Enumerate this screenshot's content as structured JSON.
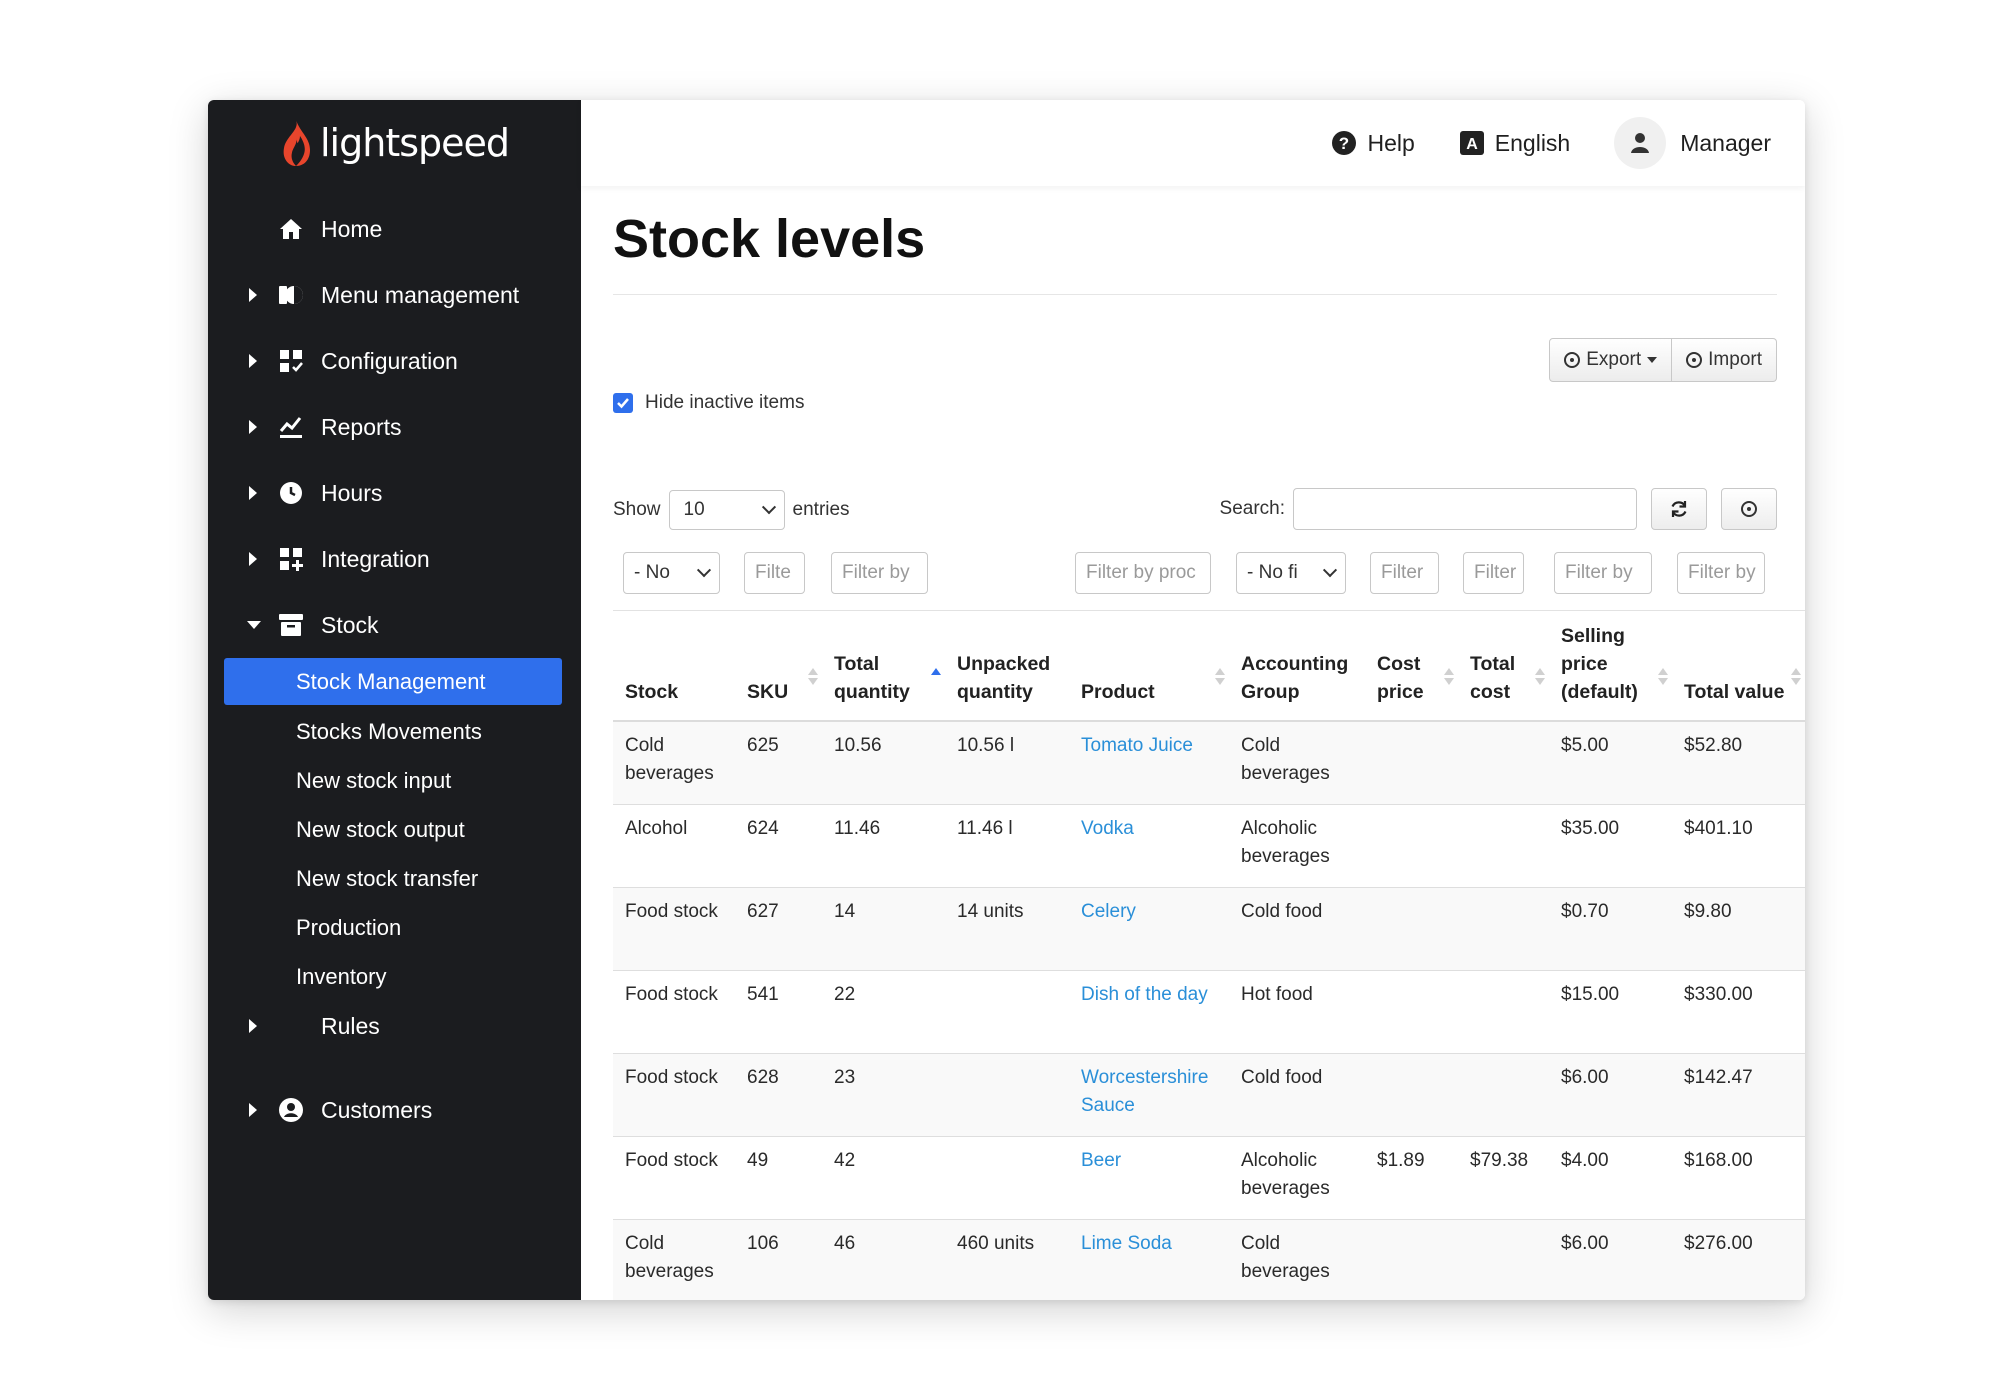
{
  "app": {
    "brand": "lightspeed",
    "accent_color": "#2f6fec",
    "brand_color": "#e8452c"
  },
  "sidebar": {
    "items": [
      {
        "label": "Home",
        "icon": "home-icon"
      },
      {
        "label": "Menu management",
        "icon": "menu-management-icon"
      },
      {
        "label": "Configuration",
        "icon": "configuration-icon"
      },
      {
        "label": "Reports",
        "icon": "reports-icon"
      },
      {
        "label": "Hours",
        "icon": "clock-icon"
      },
      {
        "label": "Integration",
        "icon": "integration-icon"
      },
      {
        "label": "Stock",
        "icon": "stock-icon"
      }
    ],
    "stock_subitems": [
      "Stock Management",
      "Stocks Movements",
      "New stock input",
      "New stock output",
      "New stock transfer",
      "Production",
      "Inventory"
    ],
    "rules_label": "Rules",
    "customers_label": "Customers"
  },
  "topbar": {
    "help": "Help",
    "language": "English",
    "user": "Manager"
  },
  "page": {
    "title": "Stock levels"
  },
  "toolbar": {
    "export": "Export",
    "import": "Import"
  },
  "options": {
    "hide_inactive_label": "Hide inactive items",
    "hide_inactive_checked": true
  },
  "length": {
    "show": "Show",
    "value": "10",
    "entries": "entries"
  },
  "search": {
    "label": "Search:",
    "value": ""
  },
  "filters": {
    "stock": "- No",
    "sku": "Filte",
    "total_quantity": "Filter by",
    "product": "Filter by proc",
    "accounting_group": "- No fi",
    "cost_price": "Filter",
    "total_cost": "Filter",
    "selling_price": "Filter by",
    "total_value": "Filter by"
  },
  "table": {
    "columns": [
      "Stock",
      "SKU",
      "Total quantity",
      "Unpacked quantity",
      "Product",
      "Accounting Group",
      "Cost price",
      "Total cost",
      "Selling price (default)",
      "Total value"
    ],
    "sorted_column": "Total quantity",
    "sort_direction": "ascending",
    "rows": [
      [
        "Cold beverages",
        "625",
        "10.56",
        "10.56 l",
        "Tomato Juice",
        "Cold beverages",
        "",
        "",
        "$5.00",
        "$52.80"
      ],
      [
        "Alcohol",
        "624",
        "11.46",
        "11.46 l",
        "Vodka",
        "Alcoholic beverages",
        "",
        "",
        "$35.00",
        "$401.10"
      ],
      [
        "Food stock",
        "627",
        "14",
        "14 units",
        "Celery",
        "Cold food",
        "",
        "",
        "$0.70",
        "$9.80"
      ],
      [
        "Food stock",
        "541",
        "22",
        "",
        "Dish of the day",
        "Hot food",
        "",
        "",
        "$15.00",
        "$330.00"
      ],
      [
        "Food stock",
        "628",
        "23",
        "",
        "Worcestershire Sauce",
        "Cold food",
        "",
        "",
        "$6.00",
        "$142.47"
      ],
      [
        "Food stock",
        "49",
        "42",
        "",
        "Beer",
        "Alcoholic beverages",
        "$1.89",
        "$79.38",
        "$4.00",
        "$168.00"
      ],
      [
        "Cold beverages",
        "106",
        "46",
        "460 units",
        "Lime Soda",
        "Cold beverages",
        "",
        "",
        "$6.00",
        "$276.00"
      ]
    ]
  }
}
